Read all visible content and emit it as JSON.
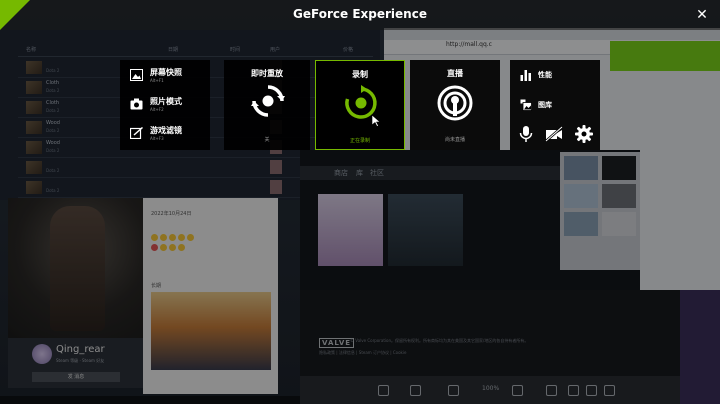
{
  "overlay": {
    "app_title": "GeForce Experience",
    "close_glyph": "✕"
  },
  "screenshot_panel": {
    "items": [
      {
        "label": "屏幕快照",
        "sub": "Alt+F1",
        "icon": "image-icon"
      },
      {
        "label": "照片模式",
        "sub": "Alt+F2",
        "icon": "camera-icon"
      },
      {
        "label": "游戏滤镜",
        "sub": "Alt+F3",
        "icon": "filter-icon"
      }
    ]
  },
  "instant_replay": {
    "title": "即时重放",
    "status": "关"
  },
  "record": {
    "title": "录制",
    "status": "正在录制"
  },
  "broadcast": {
    "title": "直播",
    "status": "尚未直播"
  },
  "side_panel": {
    "performance_label": "性能",
    "gallery_label": "图库"
  },
  "background": {
    "profile_name": "Qing_rear",
    "profile_sub": "Steam 等级 · Steam 好友",
    "profile_button": "发 消息",
    "valve_logo": "VALVE",
    "zoom": "100%",
    "footer_links": "隐私政策 | 法律信息 | Steam 订户协议 | Cookie",
    "addr_text": "http://mall.qq.c",
    "crumb_a": "商店",
    "crumb_b": "库",
    "crumb_c": "社区",
    "chat_date": "2022年10月24日",
    "chat_photo_label": "长期"
  },
  "colors": {
    "nvidia_green": "#76b900",
    "panel_black": "#000000"
  }
}
